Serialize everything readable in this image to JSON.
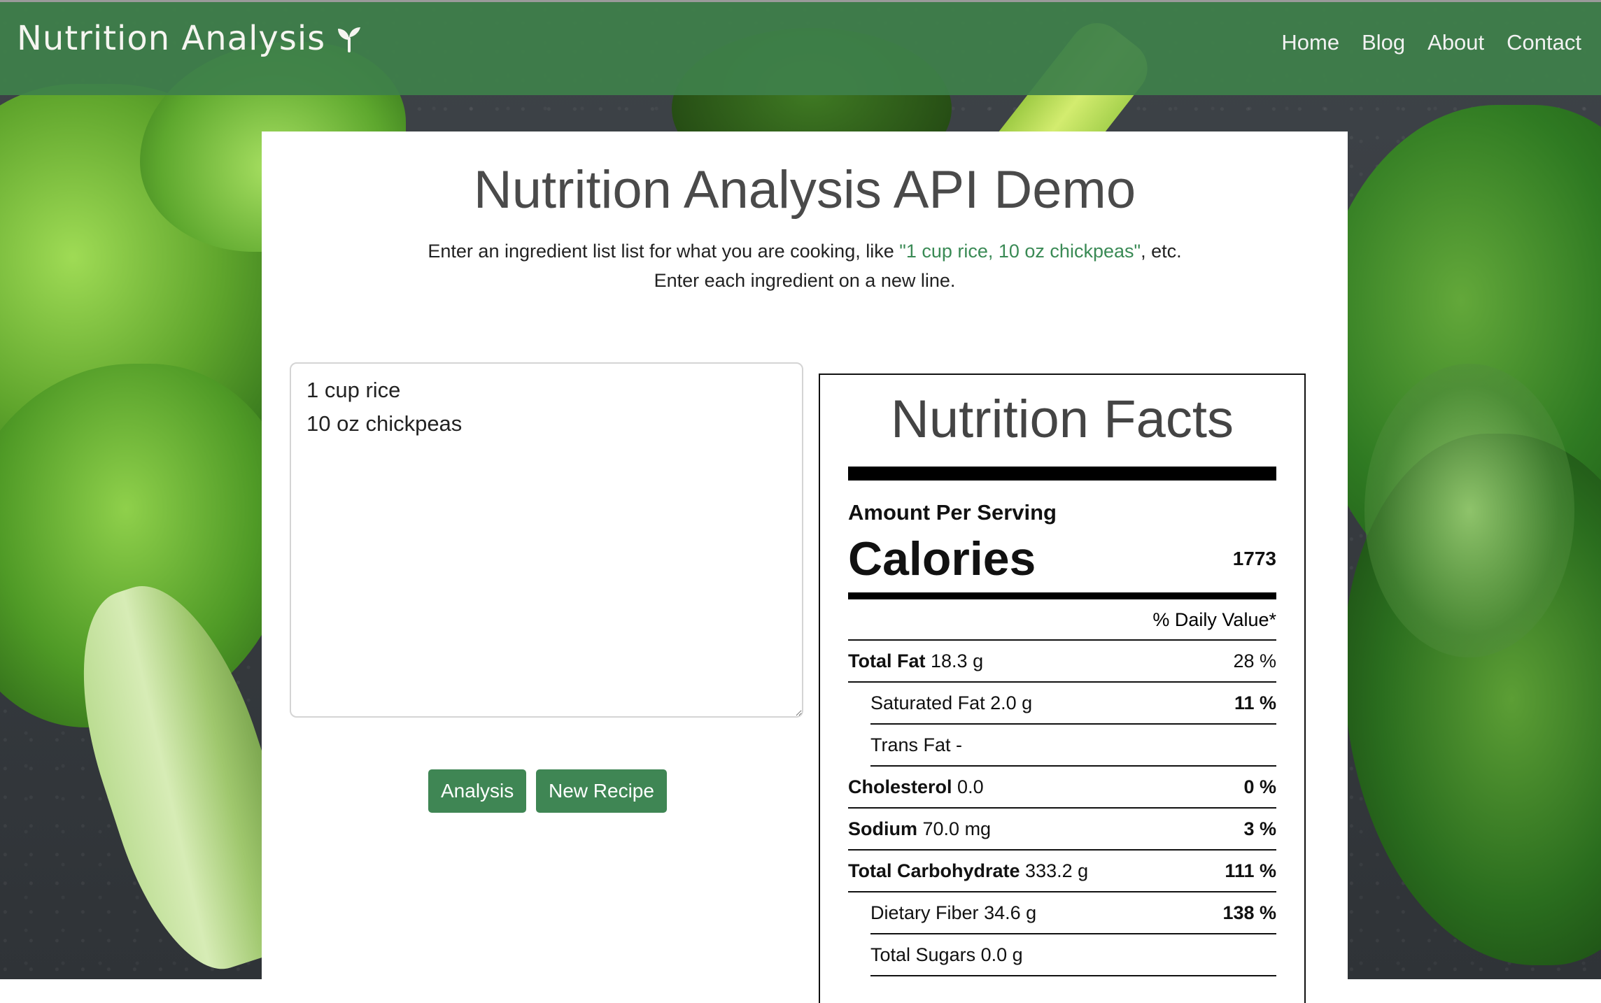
{
  "navbar": {
    "brand": "Nutrition Analysis",
    "links": [
      "Home",
      "Blog",
      "About",
      "Contact"
    ]
  },
  "main": {
    "title": "Nutrition Analysis API Demo",
    "intro_prefix": "Enter an ingredient list list for what you are cooking, like ",
    "intro_example": "\"1 cup rice, 10 oz chickpeas\"",
    "intro_suffix": ", etc.",
    "intro_line2": "Enter each ingredient on a new line.",
    "ingredients_value": "1 cup rice\n10 oz chickpeas",
    "buttons": {
      "analysis": "Analysis",
      "new_recipe": "New Recipe"
    }
  },
  "facts": {
    "title": "Nutrition Facts",
    "amount_label": "Amount Per Serving",
    "calories_label": "Calories",
    "calories_value": "1773",
    "dv_header": "% Daily Value*",
    "rows": [
      {
        "name": "Total Fat",
        "amount": "18.3 g",
        "pct": "28 %"
      },
      {
        "name": "Saturated Fat",
        "amount": "2.0 g",
        "pct": "11 %"
      },
      {
        "name": "Trans Fat",
        "amount": "-",
        "pct": ""
      },
      {
        "name": "Cholesterol",
        "amount": "0.0",
        "pct": "0 %"
      },
      {
        "name": "Sodium",
        "amount": "70.0 mg",
        "pct": "3 %"
      },
      {
        "name": "Total Carbohydrate",
        "amount": "333.2 g",
        "pct": "111 %"
      },
      {
        "name": "Dietary Fiber",
        "amount": "34.6 g",
        "pct": "138 %"
      },
      {
        "name": "Total Sugars",
        "amount": "0.0 g",
        "pct": ""
      }
    ]
  }
}
